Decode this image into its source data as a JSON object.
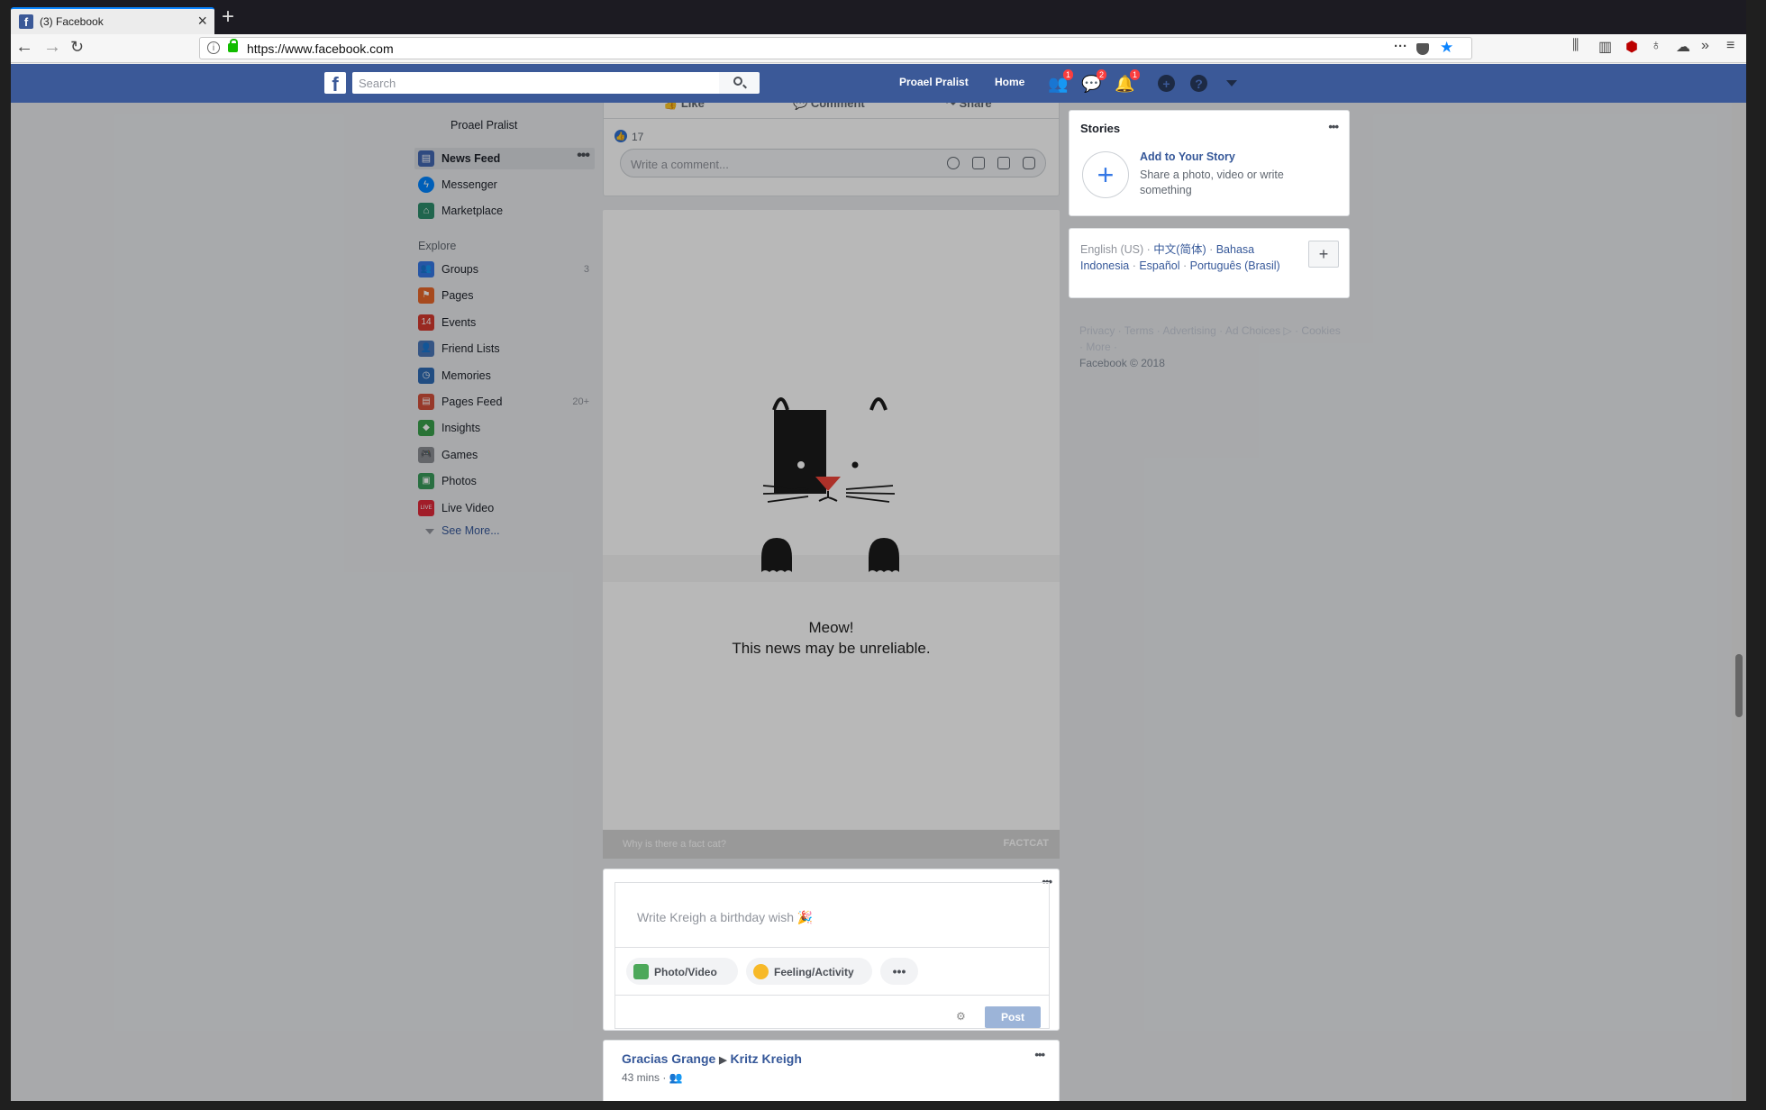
{
  "browser": {
    "tab_title": "(3) Facebook",
    "url": "https://www.facebook.com"
  },
  "fb": {
    "search_placeholder": "Search",
    "user_name": "Proael Pralist",
    "home": "Home",
    "badges": {
      "friends": "1",
      "messages": "2",
      "notifications": "1"
    }
  },
  "sidebar": {
    "user": "Proael Pralist",
    "items": [
      {
        "label": "News Feed",
        "color": "#4267b2"
      },
      {
        "label": "Messenger",
        "color": "#0084ff"
      },
      {
        "label": "Marketplace",
        "color": "#2d8c6b"
      }
    ],
    "explore_label": "Explore",
    "explore": [
      {
        "label": "Groups",
        "count": "3",
        "color": "#3578e5"
      },
      {
        "label": "Pages",
        "count": "",
        "color": "#e8672a"
      },
      {
        "label": "Events",
        "count": "",
        "color": "#d43a2f"
      },
      {
        "label": "Friend Lists",
        "count": "",
        "color": "#4a76b8"
      },
      {
        "label": "Memories",
        "count": "",
        "color": "#2f6bb5"
      },
      {
        "label": "Pages Feed",
        "count": "20+",
        "color": "#d2503b"
      },
      {
        "label": "Insights",
        "count": "",
        "color": "#3aa04b"
      },
      {
        "label": "Games",
        "count": "",
        "color": "#8b8e94"
      },
      {
        "label": "Photos",
        "count": "",
        "color": "#3a9a5b"
      },
      {
        "label": "Live Video",
        "count": "",
        "color": "#e0293a"
      }
    ],
    "see_more": "See More..."
  },
  "post": {
    "like": "Like",
    "comment": "Comment",
    "share": "Share",
    "like_count": "17",
    "comment_placeholder": "Write a comment..."
  },
  "factcat": {
    "line1": "Meow!",
    "line2": "This news may be unreliable.",
    "why": "Why is there a fact cat?",
    "brand": "FACTCAT"
  },
  "birthday": {
    "placeholder": "Write Kreigh a birthday wish 🎉",
    "photo": "Photo/Video",
    "feeling": "Feeling/Activity",
    "post": "Post"
  },
  "post2": {
    "author": "Gracias Grange",
    "target": "Kritz Kreigh",
    "time": "43 mins ·"
  },
  "stories": {
    "title": "Stories",
    "add": "Add to Your Story",
    "desc": "Share a photo, video or write something"
  },
  "languages": {
    "current": "English (US) · ",
    "l2": "中文(简体)",
    "l3": "Bahasa Indonesia",
    "l4": "Español",
    "l5": "Português (Brasil)"
  },
  "footer": {
    "links": "Privacy · Terms · Advertising · Ad Choices ▷ · Cookies · More ·",
    "copyright": "Facebook © 2018"
  }
}
